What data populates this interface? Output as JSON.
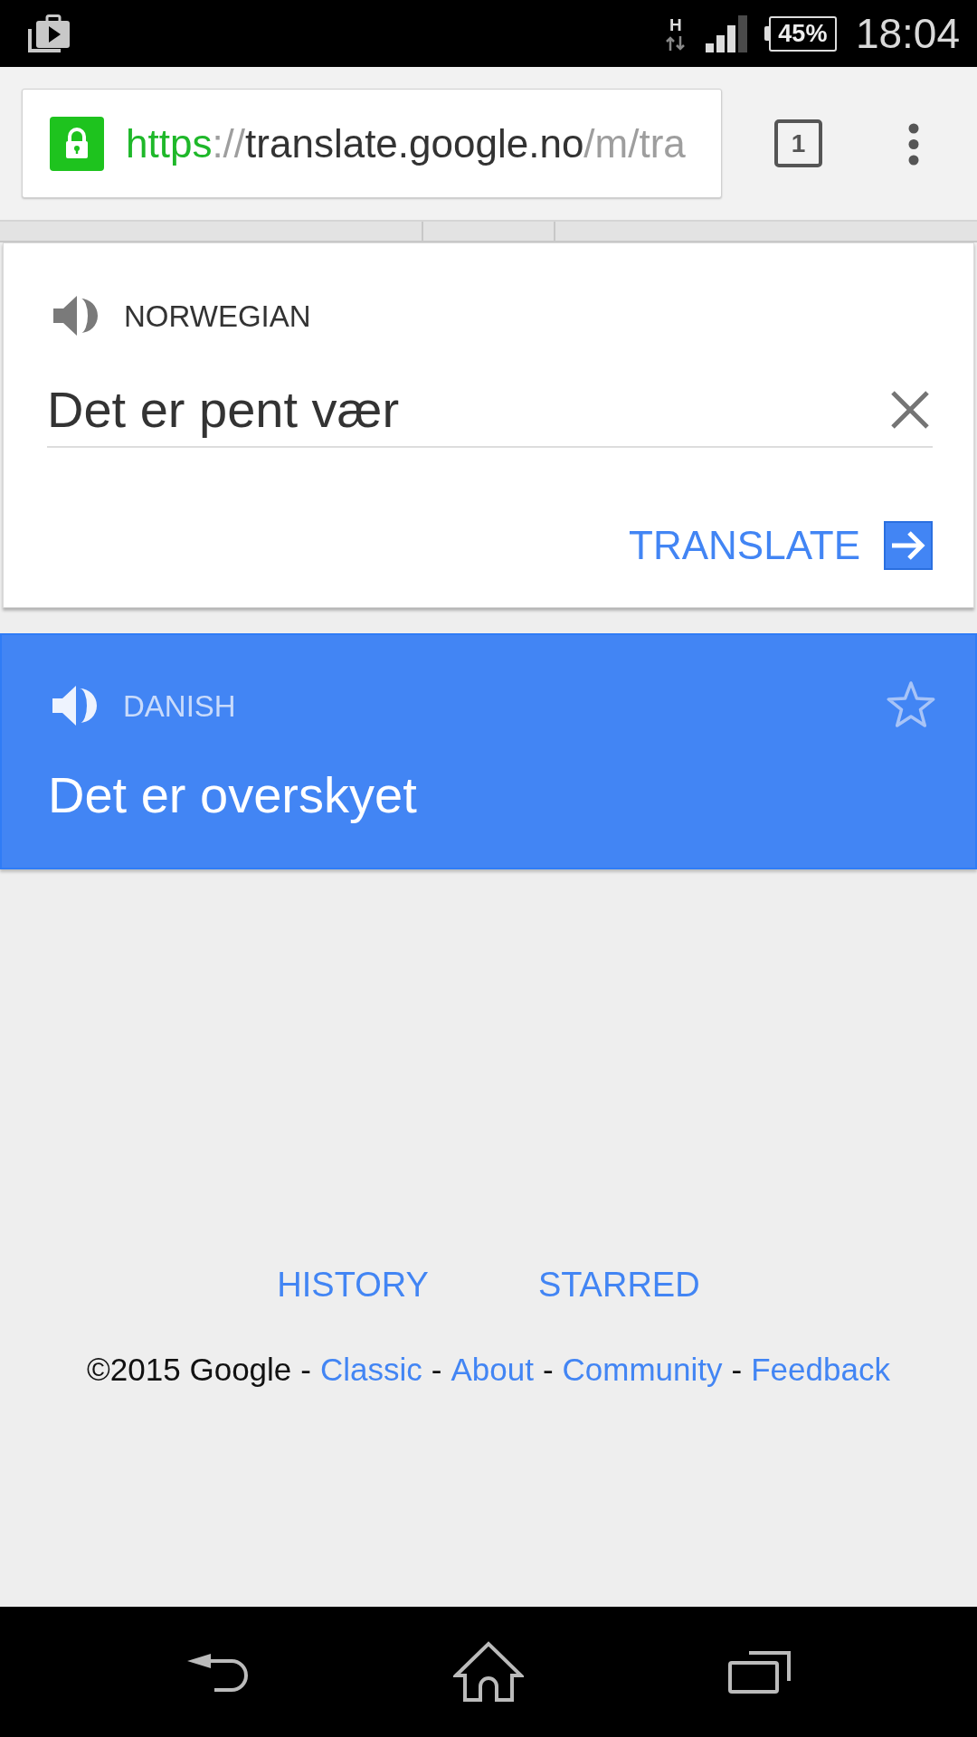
{
  "status_bar": {
    "network": "H",
    "battery": "45%",
    "time": "18:04"
  },
  "browser": {
    "address": {
      "secure": true,
      "parts": [
        {
          "kind": "scheme",
          "text": "https"
        },
        {
          "kind": "delimiter",
          "text": "://"
        },
        {
          "kind": "host",
          "text": "translate.google.no"
        },
        {
          "kind": "path",
          "text": "/m/tra"
        }
      ]
    },
    "tab_count": "1"
  },
  "source": {
    "language": "NORWEGIAN",
    "text": "Det er pent vær"
  },
  "translate_button": {
    "label": "TRANSLATE"
  },
  "result": {
    "language": "DANISH",
    "text": "Det er overskyet",
    "starred": false
  },
  "links": [
    {
      "label": "HISTORY"
    },
    {
      "label": "STARRED"
    }
  ],
  "footer": [
    {
      "kind": "text",
      "text": "©2015 Google"
    },
    {
      "kind": "separator",
      "text": "-"
    },
    {
      "kind": "link",
      "text": "Classic"
    },
    {
      "kind": "separator",
      "text": "-"
    },
    {
      "kind": "link",
      "text": "About"
    },
    {
      "kind": "separator",
      "text": "-"
    },
    {
      "kind": "link",
      "text": "Community"
    },
    {
      "kind": "separator",
      "text": "-"
    },
    {
      "kind": "link",
      "text": "Feedback"
    }
  ]
}
